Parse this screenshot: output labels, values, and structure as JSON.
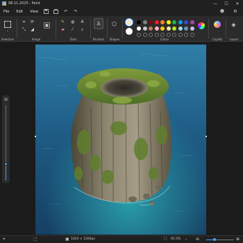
{
  "window": {
    "title": "08.11.2025 - Paint",
    "min": "—",
    "max": "☐",
    "close": "✕"
  },
  "menu": {
    "file": "File",
    "edit": "Edit",
    "view": "View"
  },
  "ribbon": {
    "groups": [
      "Selection",
      "Image",
      "Tools",
      "Brushes",
      "Shapes",
      "Colors",
      "Copilot",
      "Layers"
    ]
  },
  "colors": {
    "primary": "#efe7c9",
    "secondary": "#ffffff",
    "palette_row1": [
      "#000000",
      "#7f7f7f",
      "#880015",
      "#ed1c24",
      "#ff7f27",
      "#fff200",
      "#22b14c",
      "#00a2e8",
      "#3f48cc",
      "#a349a4"
    ],
    "palette_row2": [
      "#ffffff",
      "#c3c3c3",
      "#b97a57",
      "#ffaec9",
      "#ffc90e",
      "#efe4b0",
      "#b5e61d",
      "#99d9ea",
      "#7092be",
      "#c8bfe7"
    ]
  },
  "status": {
    "dimensions": "1024 × 1200px",
    "zoom": "65.5%",
    "zoom_fraction": 0.3,
    "side_zoom_fraction": 0.22
  },
  "icons": {
    "minimize": "minimize-icon",
    "maximize": "maximize-icon",
    "close": "close-icon",
    "save": "save-icon",
    "undo": "undo-icon",
    "redo": "redo-icon",
    "settings": "gear-icon",
    "pencil": "pencil-icon",
    "fill": "fill-icon",
    "text": "text-icon",
    "eraser": "eraser-icon",
    "picker": "color-picker-icon",
    "magnifier": "magnifier-icon"
  }
}
